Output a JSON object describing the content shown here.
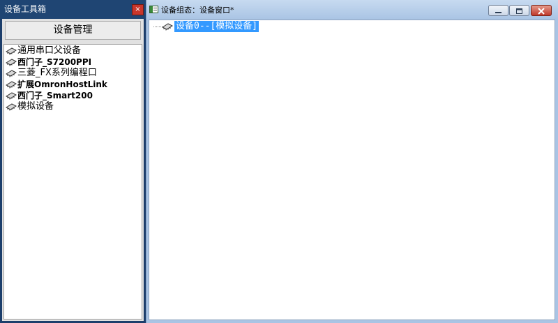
{
  "toolbox": {
    "title": "设备工具箱",
    "close_glyph": "×",
    "manage_button": "设备管理",
    "devices": [
      {
        "label": "通用串口父设备",
        "icon": "chip-icon",
        "bold": false
      },
      {
        "label": "西门子_S7200PPI",
        "icon": "chip-icon",
        "bold": true
      },
      {
        "label": "三菱_FX系列编程口",
        "icon": "chip-icon",
        "bold": false
      },
      {
        "label": "扩展OmronHostLink",
        "icon": "chip-icon",
        "bold": true
      },
      {
        "label": "西门子_Smart200",
        "icon": "chip-icon",
        "bold": true
      },
      {
        "label": "模拟设备",
        "icon": "chip-icon",
        "bold": false
      }
    ]
  },
  "device_window": {
    "title": "设备组态：设备窗口*",
    "app_icon": "window-app-icon",
    "controls": [
      "minimize-icon",
      "maximize-icon",
      "close-icon"
    ],
    "tree": {
      "node_label": "设备0--[模拟设备]",
      "node_icon": "chip-icon",
      "selected": true
    }
  },
  "colors": {
    "toolbox_frame": "#1c3e6b",
    "selection": "#3399ff",
    "close_red": "#c8362b",
    "window_frame": "#a9c4e4"
  }
}
